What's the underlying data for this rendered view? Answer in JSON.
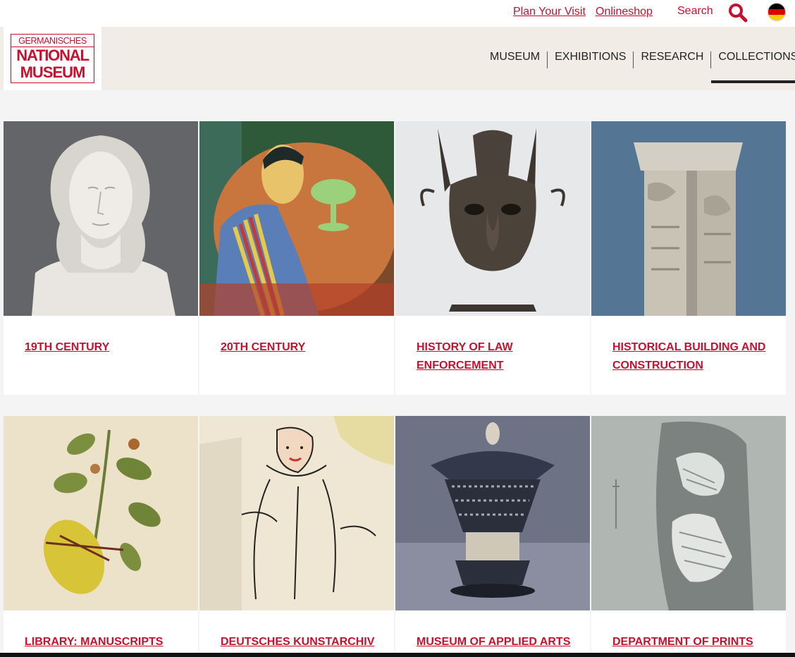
{
  "topbar": {
    "links": [
      "Plan Your Visit",
      "Onlineshop"
    ],
    "search_label": "Search",
    "language_icon": "german-flag-icon",
    "search_icon": "search-icon",
    "accent": "#c8102e"
  },
  "logo": {
    "line1": "GERMANISCHES",
    "line2": "NATIONAL",
    "line3": "MUSEUM"
  },
  "nav": {
    "items": [
      "MUSEUM",
      "EXHIBITIONS",
      "RESEARCH",
      "COLLECTIONS"
    ],
    "active": "COLLECTIONS"
  },
  "collections": [
    {
      "title": "19TH CENTURY"
    },
    {
      "title": "20TH CENTURY"
    },
    {
      "title": "HISTORY OF LAW ENFORCEMENT"
    },
    {
      "title": "HISTORICAL BUILDING AND CONSTRUCTION"
    },
    {
      "title": "LIBRARY: MANUSCRIPTS"
    },
    {
      "title": "DEUTSCHES KUNSTARCHIV"
    },
    {
      "title": "MUSEUM OF APPLIED ARTS"
    },
    {
      "title": "DEPARTMENT OF PRINTS"
    }
  ]
}
